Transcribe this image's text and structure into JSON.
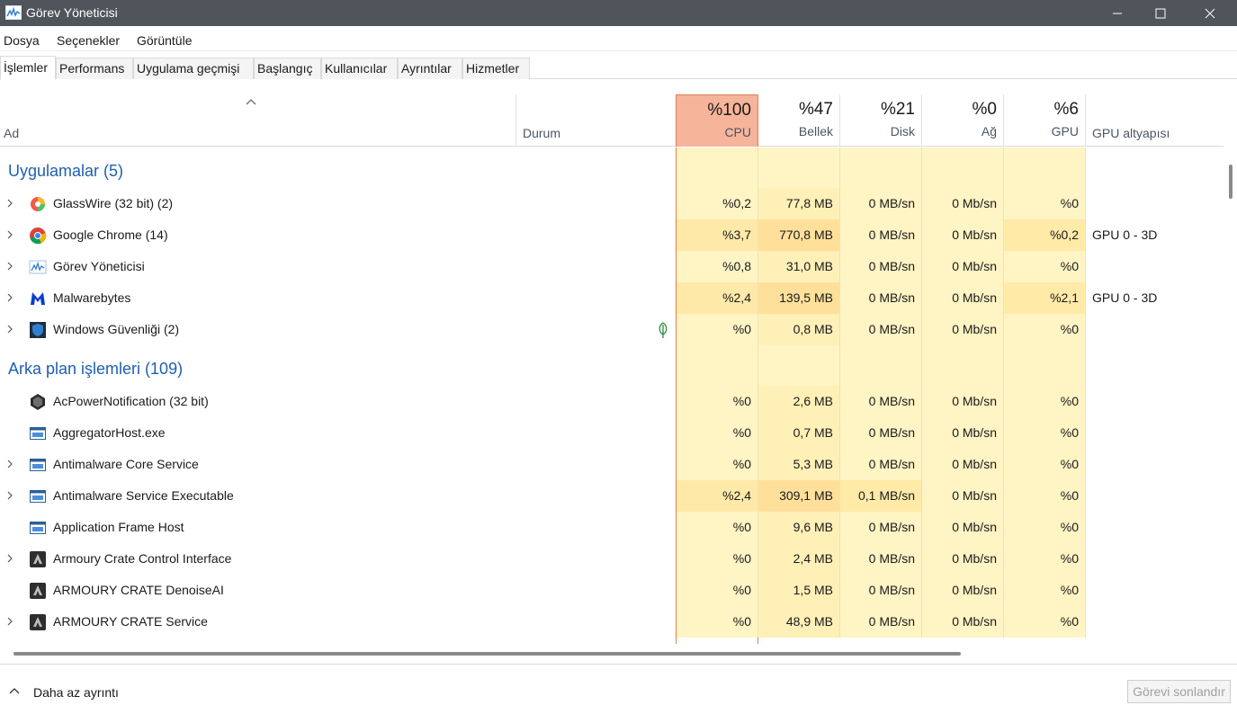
{
  "window": {
    "title": "Görev Yöneticisi"
  },
  "menu": [
    "Dosya",
    "Seçenekler",
    "Görüntüle"
  ],
  "tabs": [
    "İşlemler",
    "Performans",
    "Uygulama geçmişi",
    "Başlangıç",
    "Kullanıcılar",
    "Ayrıntılar",
    "Hizmetler"
  ],
  "active_tab": "İşlemler",
  "columns": {
    "name": "Ad",
    "status": "Durum",
    "cpu": {
      "pct": "%100",
      "label": "CPU"
    },
    "memory": {
      "pct": "%47",
      "label": "Bellek"
    },
    "disk": {
      "pct": "%21",
      "label": "Disk"
    },
    "network": {
      "pct": "%0",
      "label": "Ağ"
    },
    "gpu": {
      "pct": "%6",
      "label": "GPU"
    },
    "gpu_engine": "GPU altyapısı"
  },
  "groups": {
    "apps": "Uygulamalar (5)",
    "background": "Arka plan işlemleri (109)"
  },
  "apps": [
    {
      "name": "GlassWire (32 bit) (2)",
      "icon": "glasswire-icon",
      "expandable": true,
      "cpu": "%0,2",
      "mem": "77,8 MB",
      "disk": "0 MB/sn",
      "net": "0 Mb/sn",
      "gpu": "%0",
      "gpu_engine": ""
    },
    {
      "name": "Google Chrome (14)",
      "icon": "chrome-icon",
      "expandable": true,
      "cpu": "%3,7",
      "mem": "770,8 MB",
      "disk": "0 MB/sn",
      "net": "0 Mb/sn",
      "gpu": "%0,2",
      "gpu_engine": "GPU 0 - 3D"
    },
    {
      "name": "Görev Yöneticisi",
      "icon": "task-manager-icon",
      "expandable": true,
      "cpu": "%0,8",
      "mem": "31,0 MB",
      "disk": "0 MB/sn",
      "net": "0 Mb/sn",
      "gpu": "%0",
      "gpu_engine": ""
    },
    {
      "name": "Malwarebytes",
      "icon": "malwarebytes-icon",
      "expandable": true,
      "cpu": "%2,4",
      "mem": "139,5 MB",
      "disk": "0 MB/sn",
      "net": "0 Mb/sn",
      "gpu": "%2,1",
      "gpu_engine": "GPU 0 - 3D"
    },
    {
      "name": "Windows Güvenliği (2)",
      "icon": "windows-security-icon",
      "expandable": true,
      "status_icon": "leaf-icon",
      "cpu": "%0",
      "mem": "0,8 MB",
      "disk": "0 MB/sn",
      "net": "0 Mb/sn",
      "gpu": "%0",
      "gpu_engine": ""
    }
  ],
  "background": [
    {
      "name": "AcPowerNotification (32 bit)",
      "icon": "acpower-icon",
      "expandable": false,
      "cpu": "%0",
      "mem": "2,6 MB",
      "disk": "0 MB/sn",
      "net": "0 Mb/sn",
      "gpu": "%0",
      "gpu_engine": ""
    },
    {
      "name": "AggregatorHost.exe",
      "icon": "window-app-icon",
      "expandable": false,
      "cpu": "%0",
      "mem": "0,7 MB",
      "disk": "0 MB/sn",
      "net": "0 Mb/sn",
      "gpu": "%0",
      "gpu_engine": ""
    },
    {
      "name": "Antimalware Core Service",
      "icon": "window-app-icon",
      "expandable": true,
      "cpu": "%0",
      "mem": "5,3 MB",
      "disk": "0 MB/sn",
      "net": "0 Mb/sn",
      "gpu": "%0",
      "gpu_engine": ""
    },
    {
      "name": "Antimalware Service Executable",
      "icon": "window-app-icon",
      "expandable": true,
      "cpu": "%2,4",
      "mem": "309,1 MB",
      "disk": "0,1 MB/sn",
      "net": "0 Mb/sn",
      "gpu": "%0",
      "gpu_engine": ""
    },
    {
      "name": "Application Frame Host",
      "icon": "window-app-icon",
      "expandable": false,
      "cpu": "%0",
      "mem": "9,6 MB",
      "disk": "0 MB/sn",
      "net": "0 Mb/sn",
      "gpu": "%0",
      "gpu_engine": ""
    },
    {
      "name": "Armoury Crate Control Interface",
      "icon": "armoury-crate-icon",
      "expandable": true,
      "cpu": "%0",
      "mem": "2,4 MB",
      "disk": "0 MB/sn",
      "net": "0 Mb/sn",
      "gpu": "%0",
      "gpu_engine": ""
    },
    {
      "name": "ARMOURY CRATE DenoiseAI",
      "icon": "armoury-crate-icon",
      "expandable": false,
      "cpu": "%0",
      "mem": "1,5 MB",
      "disk": "0 MB/sn",
      "net": "0 Mb/sn",
      "gpu": "%0",
      "gpu_engine": ""
    },
    {
      "name": "ARMOURY CRATE Service",
      "icon": "armoury-crate-icon",
      "expandable": true,
      "cpu": "%0",
      "mem": "48,9 MB",
      "disk": "0 MB/sn",
      "net": "0 Mb/sn",
      "gpu": "%0",
      "gpu_engine": ""
    }
  ],
  "footer": {
    "fewer_details": "Daha az ayrıntı",
    "end_task": "Görevi sonlandır"
  },
  "colors": {
    "cpu_header": "#f6b49a",
    "heat_low": "#fff4c4",
    "heat_mid": "#ffe9a8",
    "heat_high": "#fde0a0",
    "group_title": "#1f5fb0"
  }
}
